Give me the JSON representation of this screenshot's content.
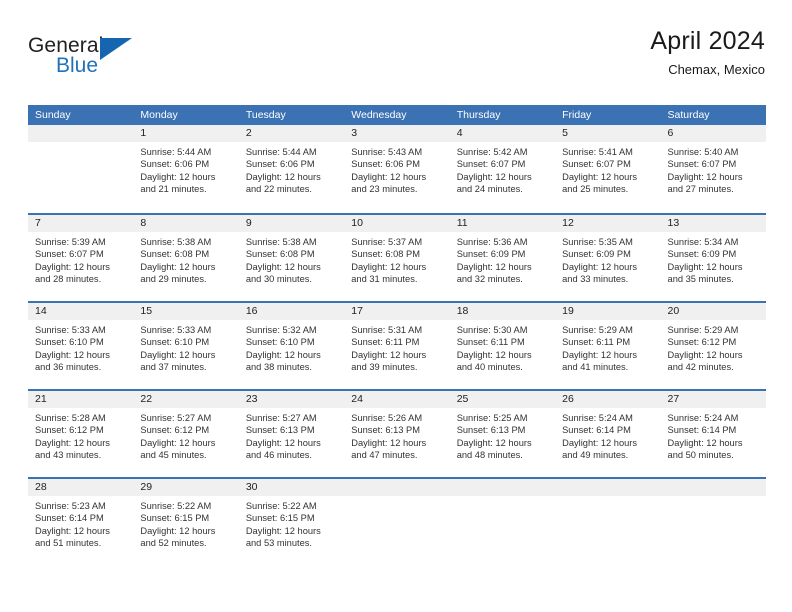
{
  "brand": {
    "name_part1": "General",
    "name_part2": "Blue"
  },
  "header": {
    "title": "April 2024",
    "location": "Chemax, Mexico"
  },
  "colors": {
    "header_blue": "#3b72b4",
    "brand_blue": "#2272b9",
    "day_band_gray": "#f0f0f0",
    "text_dark": "#333333"
  },
  "weekdays": [
    "Sunday",
    "Monday",
    "Tuesday",
    "Wednesday",
    "Thursday",
    "Friday",
    "Saturday"
  ],
  "weeks": [
    [
      {
        "day": "",
        "empty": true
      },
      {
        "day": "1",
        "sunrise": "Sunrise: 5:44 AM",
        "sunset": "Sunset: 6:06 PM",
        "daylight_line1": "Daylight: 12 hours",
        "daylight_line2": "and 21 minutes."
      },
      {
        "day": "2",
        "sunrise": "Sunrise: 5:44 AM",
        "sunset": "Sunset: 6:06 PM",
        "daylight_line1": "Daylight: 12 hours",
        "daylight_line2": "and 22 minutes."
      },
      {
        "day": "3",
        "sunrise": "Sunrise: 5:43 AM",
        "sunset": "Sunset: 6:06 PM",
        "daylight_line1": "Daylight: 12 hours",
        "daylight_line2": "and 23 minutes."
      },
      {
        "day": "4",
        "sunrise": "Sunrise: 5:42 AM",
        "sunset": "Sunset: 6:07 PM",
        "daylight_line1": "Daylight: 12 hours",
        "daylight_line2": "and 24 minutes."
      },
      {
        "day": "5",
        "sunrise": "Sunrise: 5:41 AM",
        "sunset": "Sunset: 6:07 PM",
        "daylight_line1": "Daylight: 12 hours",
        "daylight_line2": "and 25 minutes."
      },
      {
        "day": "6",
        "sunrise": "Sunrise: 5:40 AM",
        "sunset": "Sunset: 6:07 PM",
        "daylight_line1": "Daylight: 12 hours",
        "daylight_line2": "and 27 minutes."
      }
    ],
    [
      {
        "day": "7",
        "sunrise": "Sunrise: 5:39 AM",
        "sunset": "Sunset: 6:07 PM",
        "daylight_line1": "Daylight: 12 hours",
        "daylight_line2": "and 28 minutes."
      },
      {
        "day": "8",
        "sunrise": "Sunrise: 5:38 AM",
        "sunset": "Sunset: 6:08 PM",
        "daylight_line1": "Daylight: 12 hours",
        "daylight_line2": "and 29 minutes."
      },
      {
        "day": "9",
        "sunrise": "Sunrise: 5:38 AM",
        "sunset": "Sunset: 6:08 PM",
        "daylight_line1": "Daylight: 12 hours",
        "daylight_line2": "and 30 minutes."
      },
      {
        "day": "10",
        "sunrise": "Sunrise: 5:37 AM",
        "sunset": "Sunset: 6:08 PM",
        "daylight_line1": "Daylight: 12 hours",
        "daylight_line2": "and 31 minutes."
      },
      {
        "day": "11",
        "sunrise": "Sunrise: 5:36 AM",
        "sunset": "Sunset: 6:09 PM",
        "daylight_line1": "Daylight: 12 hours",
        "daylight_line2": "and 32 minutes."
      },
      {
        "day": "12",
        "sunrise": "Sunrise: 5:35 AM",
        "sunset": "Sunset: 6:09 PM",
        "daylight_line1": "Daylight: 12 hours",
        "daylight_line2": "and 33 minutes."
      },
      {
        "day": "13",
        "sunrise": "Sunrise: 5:34 AM",
        "sunset": "Sunset: 6:09 PM",
        "daylight_line1": "Daylight: 12 hours",
        "daylight_line2": "and 35 minutes."
      }
    ],
    [
      {
        "day": "14",
        "sunrise": "Sunrise: 5:33 AM",
        "sunset": "Sunset: 6:10 PM",
        "daylight_line1": "Daylight: 12 hours",
        "daylight_line2": "and 36 minutes."
      },
      {
        "day": "15",
        "sunrise": "Sunrise: 5:33 AM",
        "sunset": "Sunset: 6:10 PM",
        "daylight_line1": "Daylight: 12 hours",
        "daylight_line2": "and 37 minutes."
      },
      {
        "day": "16",
        "sunrise": "Sunrise: 5:32 AM",
        "sunset": "Sunset: 6:10 PM",
        "daylight_line1": "Daylight: 12 hours",
        "daylight_line2": "and 38 minutes."
      },
      {
        "day": "17",
        "sunrise": "Sunrise: 5:31 AM",
        "sunset": "Sunset: 6:11 PM",
        "daylight_line1": "Daylight: 12 hours",
        "daylight_line2": "and 39 minutes."
      },
      {
        "day": "18",
        "sunrise": "Sunrise: 5:30 AM",
        "sunset": "Sunset: 6:11 PM",
        "daylight_line1": "Daylight: 12 hours",
        "daylight_line2": "and 40 minutes."
      },
      {
        "day": "19",
        "sunrise": "Sunrise: 5:29 AM",
        "sunset": "Sunset: 6:11 PM",
        "daylight_line1": "Daylight: 12 hours",
        "daylight_line2": "and 41 minutes."
      },
      {
        "day": "20",
        "sunrise": "Sunrise: 5:29 AM",
        "sunset": "Sunset: 6:12 PM",
        "daylight_line1": "Daylight: 12 hours",
        "daylight_line2": "and 42 minutes."
      }
    ],
    [
      {
        "day": "21",
        "sunrise": "Sunrise: 5:28 AM",
        "sunset": "Sunset: 6:12 PM",
        "daylight_line1": "Daylight: 12 hours",
        "daylight_line2": "and 43 minutes."
      },
      {
        "day": "22",
        "sunrise": "Sunrise: 5:27 AM",
        "sunset": "Sunset: 6:12 PM",
        "daylight_line1": "Daylight: 12 hours",
        "daylight_line2": "and 45 minutes."
      },
      {
        "day": "23",
        "sunrise": "Sunrise: 5:27 AM",
        "sunset": "Sunset: 6:13 PM",
        "daylight_line1": "Daylight: 12 hours",
        "daylight_line2": "and 46 minutes."
      },
      {
        "day": "24",
        "sunrise": "Sunrise: 5:26 AM",
        "sunset": "Sunset: 6:13 PM",
        "daylight_line1": "Daylight: 12 hours",
        "daylight_line2": "and 47 minutes."
      },
      {
        "day": "25",
        "sunrise": "Sunrise: 5:25 AM",
        "sunset": "Sunset: 6:13 PM",
        "daylight_line1": "Daylight: 12 hours",
        "daylight_line2": "and 48 minutes."
      },
      {
        "day": "26",
        "sunrise": "Sunrise: 5:24 AM",
        "sunset": "Sunset: 6:14 PM",
        "daylight_line1": "Daylight: 12 hours",
        "daylight_line2": "and 49 minutes."
      },
      {
        "day": "27",
        "sunrise": "Sunrise: 5:24 AM",
        "sunset": "Sunset: 6:14 PM",
        "daylight_line1": "Daylight: 12 hours",
        "daylight_line2": "and 50 minutes."
      }
    ],
    [
      {
        "day": "28",
        "sunrise": "Sunrise: 5:23 AM",
        "sunset": "Sunset: 6:14 PM",
        "daylight_line1": "Daylight: 12 hours",
        "daylight_line2": "and 51 minutes."
      },
      {
        "day": "29",
        "sunrise": "Sunrise: 5:22 AM",
        "sunset": "Sunset: 6:15 PM",
        "daylight_line1": "Daylight: 12 hours",
        "daylight_line2": "and 52 minutes."
      },
      {
        "day": "30",
        "sunrise": "Sunrise: 5:22 AM",
        "sunset": "Sunset: 6:15 PM",
        "daylight_line1": "Daylight: 12 hours",
        "daylight_line2": "and 53 minutes."
      },
      {
        "day": "",
        "empty": true
      },
      {
        "day": "",
        "empty": true
      },
      {
        "day": "",
        "empty": true
      },
      {
        "day": "",
        "empty": true
      }
    ]
  ]
}
